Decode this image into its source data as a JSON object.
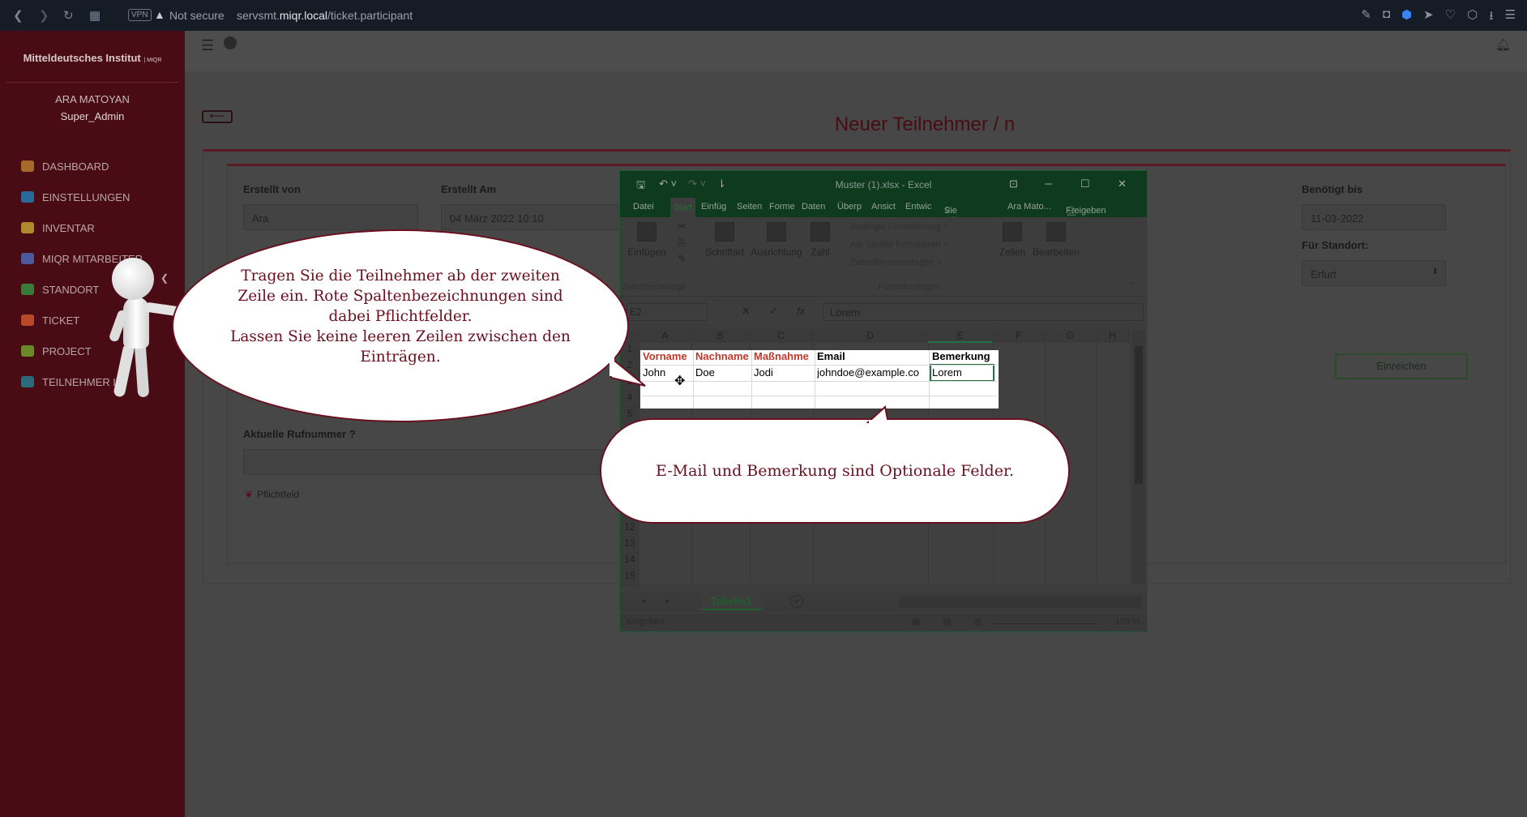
{
  "browser": {
    "vpn": "VPN",
    "not_secure": "Not secure",
    "url_prefix": "servsmt.",
    "url_domain": "miqr.local",
    "url_path": "/ticket.participant"
  },
  "sidebar": {
    "brand": "Mitteldeutsches Institut",
    "brand_small": "| MIQR",
    "user_name": "ARA MATOYAN",
    "user_role": "Super_Admin",
    "items": [
      {
        "label": "DASHBOARD",
        "color": "#a86a2a"
      },
      {
        "label": "EINSTELLUNGEN",
        "color": "#2a6a9a"
      },
      {
        "label": "INVENTAR",
        "color": "#b08a2a"
      },
      {
        "label": "MIQR MITARBEITER",
        "color": "#4a5a9a"
      },
      {
        "label": "STANDORT",
        "color": "#3a7a3a"
      },
      {
        "label": "TICKET",
        "color": "#b84a2a"
      },
      {
        "label": "PROJECT",
        "color": "#6a8a2a"
      },
      {
        "label": "TEILNEHMER LI",
        "color": "#2a6a7a"
      }
    ]
  },
  "page": {
    "back_arrow": "⟵",
    "title": "Neuer Teilnehmer / n",
    "erstellt_von_label": "Erstellt von",
    "erstellt_von_value": "Ara",
    "erstellt_am_label": "Erstellt Am",
    "erstellt_am_value": "04 März 2022 10:10",
    "benoetigt_label": "Benötigt bis",
    "benoetigt_value": "11-03-2022",
    "standort_label": "Für Standort:",
    "standort_value": "Erfurt",
    "rufnummer_label": "Aktuelle Rufnummer ?",
    "pflichtfeld": "Pflichtfeld",
    "submit": "Einreichen"
  },
  "excel": {
    "title": "Muster (1).xlsx - Excel",
    "tabs": [
      "Datei",
      "Start",
      "Einfüg",
      "Seiten",
      "Forme",
      "Daten",
      "Überp",
      "Ansict",
      "Entwic"
    ],
    "tell_me": "Sie wüns",
    "account": "Ara Mato...",
    "share": "Freigeben",
    "ribbon": {
      "paste": "Einfügen",
      "font": "Schriftart",
      "alignment": "Ausrichtung",
      "number": "Zahl",
      "cond_format": "Bedingte Formatierung ˅",
      "as_table": "Als Tabelle formatieren ˅",
      "cell_styles": "Zellenformatvorlagen ˅",
      "cells": "Zellen",
      "edit": "Bearbeiten",
      "clipboard": "Zwischenablage",
      "styles": "Formatvorlagen"
    },
    "name_box": "E2",
    "formula": "Lorem",
    "columns": [
      "A",
      "B",
      "C",
      "D",
      "E",
      "F",
      "G",
      "H"
    ],
    "rows": [
      "1",
      "2",
      "3",
      "4",
      "5",
      "6",
      "7",
      "8",
      "9",
      "10",
      "11",
      "12",
      "13",
      "14",
      "15"
    ],
    "headers": [
      "Vorname",
      "Nachname",
      "Maßnahme",
      "Email",
      "Bemerkung"
    ],
    "row2": [
      "John",
      "Doe",
      "Jodi",
      "johndoe@example.co",
      "Lorem"
    ],
    "sheet": "Tabelle1",
    "status": "Eingeben",
    "zoom": "100 %"
  },
  "callouts": {
    "bubble1": "Tragen Sie die Teilnehmer ab der zweiten Zeile ein. Rote Spaltenbezeichnungen sind dabei Pflichtfelder.\nLassen Sie keine leeren Zeilen zwischen den Einträgen.",
    "bubble2": "E-Mail und Bemerkung sind Optionale Felder."
  }
}
